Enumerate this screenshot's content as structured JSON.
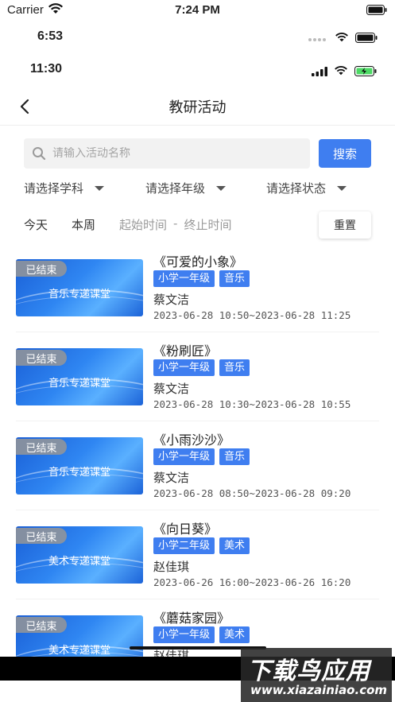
{
  "status_bars": [
    {
      "carrier": "Carrier",
      "time": "7:24 PM"
    },
    {
      "time": "6:53"
    },
    {
      "time": "11:30"
    }
  ],
  "nav": {
    "title": "教研活动"
  },
  "search": {
    "placeholder": "请输入活动名称",
    "button_label": "搜索"
  },
  "filters": [
    {
      "label": "请选择学科"
    },
    {
      "label": "请选择年级"
    },
    {
      "label": "请选择状态"
    }
  ],
  "dates": {
    "today": "今天",
    "this_week": "本周",
    "start": "起始时间",
    "dash": "-",
    "end": "终止时间",
    "reset_label": "重置"
  },
  "activities": [
    {
      "status": "已结束",
      "caption": "音乐专递课堂",
      "title": "《可爱的小象》",
      "grade": "小学一年级",
      "subject": "音乐",
      "teacher": "蔡文洁",
      "time": "2023-06-28 10:50~2023-06-28 11:25"
    },
    {
      "status": "已结束",
      "caption": "音乐专递课堂",
      "title": "《粉刷匠》",
      "grade": "小学一年级",
      "subject": "音乐",
      "teacher": "蔡文洁",
      "time": "2023-06-28 10:30~2023-06-28 10:55"
    },
    {
      "status": "已结束",
      "caption": "音乐专递课堂",
      "title": "《小雨沙沙》",
      "grade": "小学一年级",
      "subject": "音乐",
      "teacher": "蔡文洁",
      "time": "2023-06-28 08:50~2023-06-28 09:20"
    },
    {
      "status": "已结束",
      "caption": "美术专递课堂",
      "title": "《向日葵》",
      "grade": "小学二年级",
      "subject": "美术",
      "teacher": "赵佳琪",
      "time": "2023-06-26 16:00~2023-06-26 16:20"
    },
    {
      "status": "已结束",
      "caption": "美术专递课堂",
      "title": "《蘑菇家园》",
      "grade": "小学一年级",
      "subject": "美术",
      "teacher": "赵佳琪",
      "time": ""
    }
  ],
  "watermark": {
    "big": "下载鸟应用",
    "small": "www.xiazainiao.com"
  },
  "colors": {
    "accent": "#3f7ef0",
    "status_badge": "#969696"
  }
}
